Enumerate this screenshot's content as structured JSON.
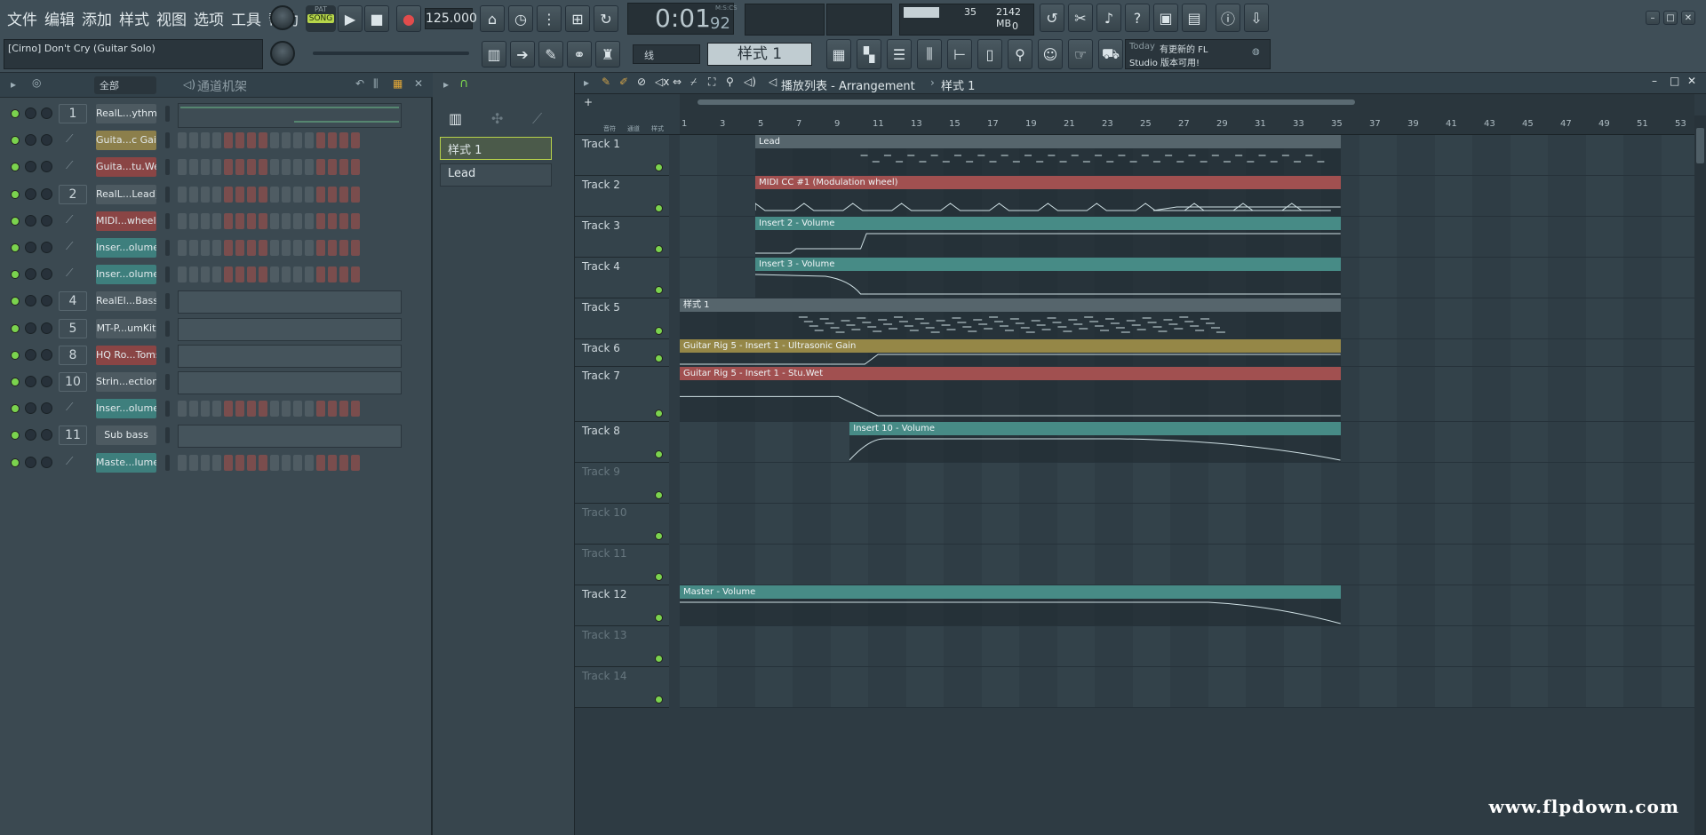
{
  "menu": [
    "文件",
    "编辑",
    "添加",
    "样式",
    "视图",
    "选项",
    "工具",
    "帮助"
  ],
  "transport": {
    "pat_label": "PAT",
    "song_label": "SONG",
    "tempo": "125.000",
    "time": "0:01",
    "time_sub": "92",
    "time_mode": "M:S:CS"
  },
  "perf": {
    "cpu": "35",
    "mem": "2142 MB",
    "poly": "0"
  },
  "hint": {
    "project": "[Cirno] Don't Cry (Guitar Solo)"
  },
  "snap": {
    "value": "线"
  },
  "pattern_selector": {
    "current": "样式 1"
  },
  "news": {
    "today": "Today",
    "line1": "有更新的 FL",
    "line2": "Studio 版本可用!"
  },
  "channel_rack": {
    "filter": "全部",
    "title": "通道机架",
    "channels": [
      {
        "num": "1",
        "name": "RealL...ythm)",
        "color": "#4d5a61",
        "type": "graph"
      },
      {
        "num": "",
        "name": "Guita...c Gain",
        "color": "#8c7f4b",
        "type": "steps"
      },
      {
        "num": "",
        "name": "Guita...tu.Wet",
        "color": "#8a4545",
        "type": "steps"
      },
      {
        "num": "2",
        "name": "RealL...Lead)",
        "color": "#4d5a61",
        "type": "steps"
      },
      {
        "num": "",
        "name": "MIDI...wheel)",
        "color": "#8a4545",
        "type": "steps"
      },
      {
        "num": "",
        "name": "Inser...olume",
        "color": "#3e7f7d",
        "type": "steps"
      },
      {
        "num": "",
        "name": "Inser...olume",
        "color": "#3e7f7d",
        "type": "steps"
      },
      {
        "num": "4",
        "name": "RealEl...Bass)",
        "color": "#4d5a61",
        "type": "empty"
      },
      {
        "num": "5",
        "name": "MT-P...umKit",
        "color": "#4d5a61",
        "type": "empty"
      },
      {
        "num": "8",
        "name": "HQ Ro...Toms",
        "color": "#8a4545",
        "type": "empty"
      },
      {
        "num": "10",
        "name": "Strin...ection",
        "color": "#4d5a61",
        "type": "empty"
      },
      {
        "num": "",
        "name": "Inser...olume",
        "color": "#3e7f7d",
        "type": "steps"
      },
      {
        "num": "11",
        "name": "Sub bass",
        "color": "#4d5a61",
        "type": "empty"
      },
      {
        "num": "",
        "name": "Maste...lume",
        "color": "#3e7f7d",
        "type": "steps"
      }
    ]
  },
  "patterns": {
    "items": [
      "样式 1",
      "Lead"
    ]
  },
  "playlist": {
    "title": "播放列表 - Arrangement",
    "pattern": "样式 1",
    "view_tabs": [
      "音符",
      "通道",
      "样式"
    ],
    "ruler": [
      "1",
      "3",
      "5",
      "7",
      "9",
      "11",
      "13",
      "15",
      "17",
      "19",
      "21",
      "23",
      "25",
      "27",
      "29",
      "31",
      "33",
      "35",
      "37",
      "39",
      "41",
      "43",
      "45",
      "47",
      "49",
      "51",
      "53"
    ],
    "tracks": [
      {
        "name": "Track 1",
        "clip": "Lead",
        "color": "#56656c",
        "start": 2,
        "end": 17.5,
        "kind": "notes"
      },
      {
        "name": "Track 2",
        "clip": "MIDI CC #1 (Modulation wheel)",
        "color": "#a15050",
        "start": 2,
        "end": 17.5,
        "kind": "spiky"
      },
      {
        "name": "Track 3",
        "clip": "Insert 2 - Volume",
        "color": "#478b86",
        "start": 2,
        "end": 17.5,
        "kind": "stepup"
      },
      {
        "name": "Track 4",
        "clip": "Insert 3 - Volume",
        "color": "#478b86",
        "start": 2,
        "end": 17.5,
        "kind": "down"
      },
      {
        "name": "Track 5",
        "clip": "样式 1",
        "color": "#56656c",
        "start": 0,
        "end": 17.5,
        "kind": "dense"
      },
      {
        "name": "Track 6",
        "clip": "Guitar Rig 5 - Insert 1 - Ultrasonic Gain",
        "color": "#958747",
        "start": 0,
        "end": 17.5,
        "kind": "rise"
      },
      {
        "name": "Track 7",
        "clip": "Guitar Rig 5 - Insert 1 - Stu.Wet",
        "color": "#a15050",
        "start": 0,
        "end": 17.5,
        "kind": "fall"
      },
      {
        "name": "Track 8",
        "clip": "Insert 10 - Volume",
        "color": "#478b86",
        "start": 4.5,
        "end": 17.5,
        "kind": "bell"
      },
      {
        "name": "Track 9",
        "clip": "",
        "start": 0,
        "end": 0,
        "kind": "none"
      },
      {
        "name": "Track 10",
        "clip": "",
        "start": 0,
        "end": 0,
        "kind": "none"
      },
      {
        "name": "Track 11",
        "clip": "",
        "start": 0,
        "end": 0,
        "kind": "none"
      },
      {
        "name": "Track 12",
        "clip": "Master - Volume",
        "color": "#478b86",
        "start": 0,
        "end": 17.5,
        "kind": "fadeout"
      },
      {
        "name": "Track 13",
        "clip": "",
        "start": 0,
        "end": 0,
        "kind": "none"
      },
      {
        "name": "Track 14",
        "clip": "",
        "start": 0,
        "end": 0,
        "kind": "none"
      }
    ]
  },
  "watermark": "www.flpdown.com"
}
